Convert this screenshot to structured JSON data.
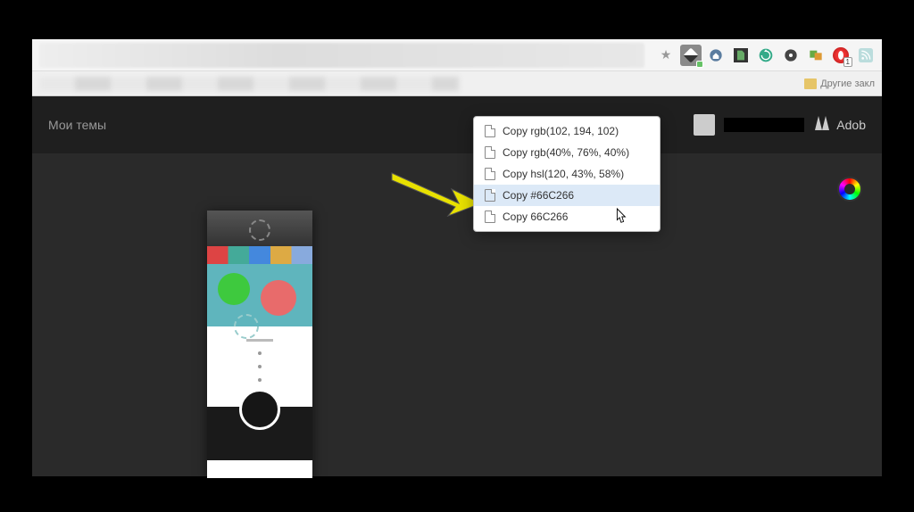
{
  "browser": {
    "bookmarks_other": "Другие закл",
    "extensions": {
      "star": "star-icon",
      "eyedropper": "eyedropper-icon",
      "home": "home-icon",
      "evernote": "evernote-icon",
      "refresh": "refresh-icon",
      "disc": "disc-icon",
      "translate": "translate-icon",
      "opera_count": "1",
      "rss": "rss-icon"
    }
  },
  "app": {
    "header_title": "Мои темы",
    "brand": "Adob"
  },
  "menu": {
    "items": [
      {
        "label": "Copy rgb(102, 194, 102)"
      },
      {
        "label": "Copy rgb(40%, 76%, 40%)"
      },
      {
        "label": "Copy hsl(120, 43%, 58%)"
      },
      {
        "label": "Copy #66C266"
      },
      {
        "label": "Copy 66C266"
      }
    ],
    "hovered_index": 3
  }
}
